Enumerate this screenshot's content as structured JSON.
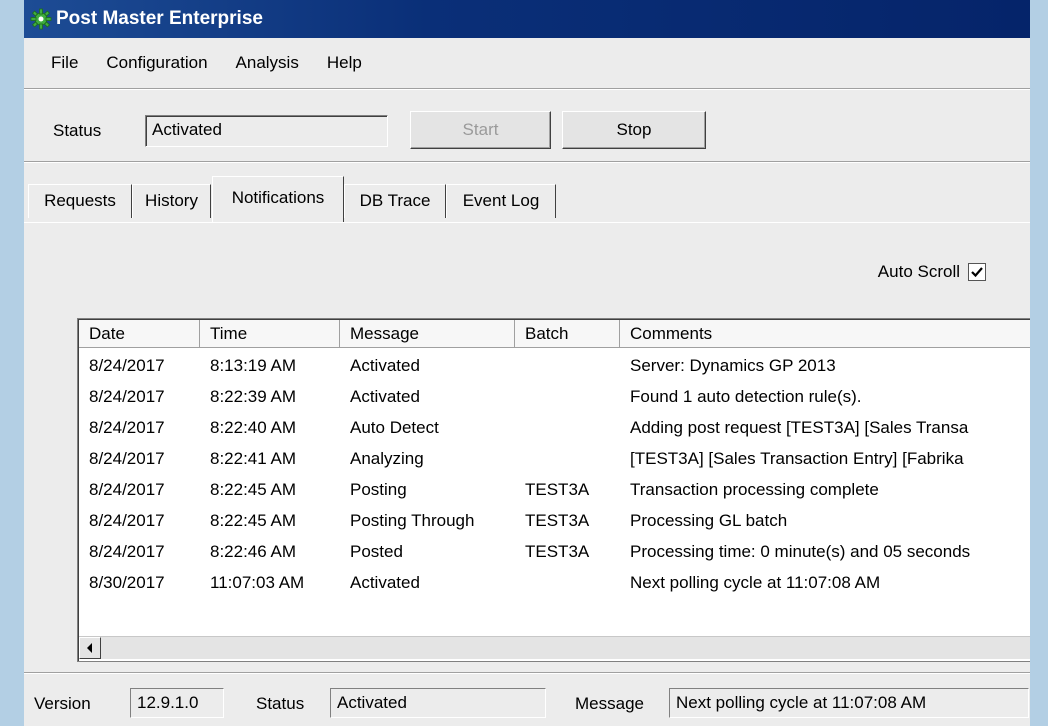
{
  "window": {
    "title": "Post Master Enterprise",
    "app_icon": "gear-icon",
    "colors": {
      "titlebar": "#0a2f78",
      "background": "#ececec",
      "desktop": "#b3cfe4"
    }
  },
  "menu": [
    "File",
    "Configuration",
    "Analysis",
    "Help"
  ],
  "status_panel": {
    "label": "Status",
    "value": "Activated",
    "start_label": "Start",
    "stop_label": "Stop"
  },
  "tabs": [
    "Requests",
    "History",
    "Notifications",
    "DB Trace",
    "Event Log"
  ],
  "active_tab": "Notifications",
  "auto_scroll": {
    "label": "Auto Scroll",
    "checked": true
  },
  "table": {
    "columns": [
      "Date",
      "Time",
      "Message",
      "Batch",
      "Comments"
    ],
    "rows": [
      [
        "8/24/2017",
        "8:13:19 AM",
        "Activated",
        "",
        "Server: Dynamics GP 2013"
      ],
      [
        "8/24/2017",
        "8:22:39 AM",
        "Activated",
        "",
        "Found 1 auto detection rule(s)."
      ],
      [
        "8/24/2017",
        "8:22:40 AM",
        "Auto Detect",
        "",
        "Adding post request [TEST3A]  [Sales Transa"
      ],
      [
        "8/24/2017",
        "8:22:41 AM",
        "Analyzing",
        "",
        "[TEST3A]  [Sales Transaction Entry]  [Fabrika"
      ],
      [
        "8/24/2017",
        "8:22:45 AM",
        "Posting",
        "TEST3A",
        "Transaction processing complete"
      ],
      [
        "8/24/2017",
        "8:22:45 AM",
        "Posting Through",
        "TEST3A",
        "Processing GL batch"
      ],
      [
        "8/24/2017",
        "8:22:46 AM",
        "Posted",
        "TEST3A",
        "Processing time: 0 minute(s) and 05 seconds"
      ],
      [
        "8/30/2017",
        "11:07:03 AM",
        "Activated",
        "",
        "Next polling cycle at 11:07:08 AM"
      ]
    ]
  },
  "statusbar": {
    "version_label": "Version",
    "version_value": "12.9.1.0",
    "status_label": "Status",
    "status_value": "Activated",
    "message_label": "Message",
    "message_value": "Next polling cycle at 11:07:08 AM"
  }
}
